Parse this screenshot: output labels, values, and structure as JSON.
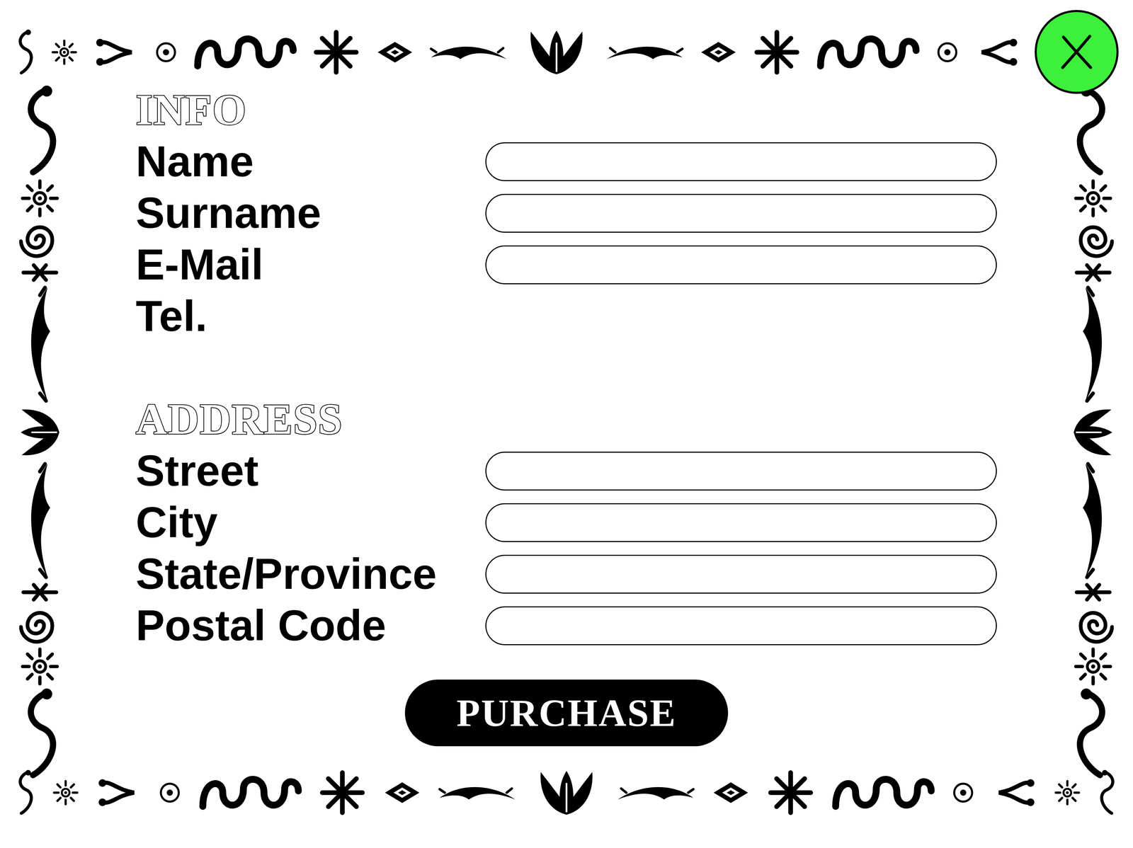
{
  "info": {
    "heading": "INFO",
    "fields": [
      {
        "label": "Name",
        "kind": "input"
      },
      {
        "label": "Surname",
        "kind": "input"
      },
      {
        "label": "E-Mail",
        "kind": "input"
      },
      {
        "label": "Tel.",
        "kind": "label"
      }
    ]
  },
  "address": {
    "heading": "ADDRESS",
    "fields": [
      {
        "label": "Street",
        "kind": "input"
      },
      {
        "label": "City",
        "kind": "input"
      },
      {
        "label": "State/Province",
        "kind": "input"
      },
      {
        "label": "Postal Code",
        "kind": "input"
      }
    ]
  },
  "purchase_button": "PURCHASE"
}
